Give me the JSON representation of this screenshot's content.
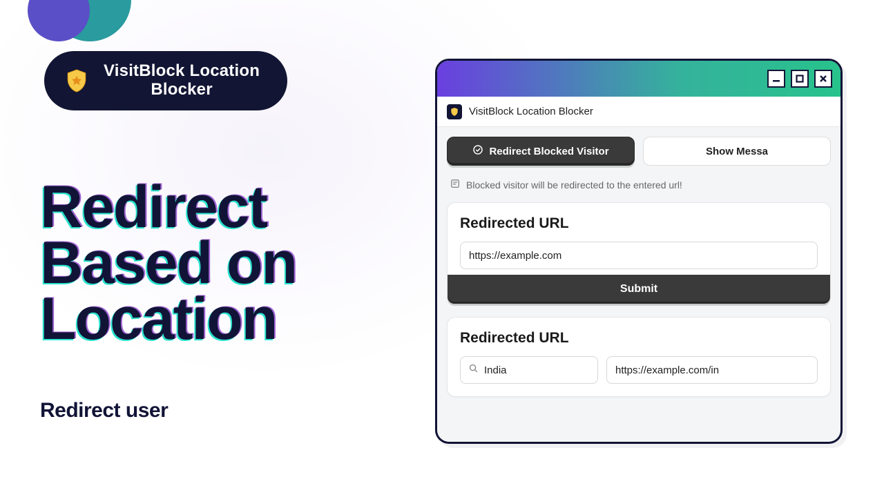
{
  "badge": {
    "title_line1": "VisitBlock Location",
    "title_line2": "Blocker"
  },
  "hero": {
    "heading_line1": "Redirect",
    "heading_line2": "Based on",
    "heading_line3": "Location",
    "subhead": "Redirect user"
  },
  "window": {
    "app_title": "VisitBlock Location Blocker",
    "tab_redirect": "Redirect Blocked Visitor",
    "tab_show_message": "Show Messa",
    "hint_text": "Blocked visitor will be redirected to the entered url!",
    "card1_title": "Redirected URL",
    "card1_input_value": "https://example.com",
    "card1_submit": "Submit",
    "card2_title": "Redirected URL",
    "card2_search_value": "India",
    "card2_url_value": "https://example.com/in"
  },
  "colors": {
    "navy": "#121533",
    "teal": "#29e3cf"
  }
}
